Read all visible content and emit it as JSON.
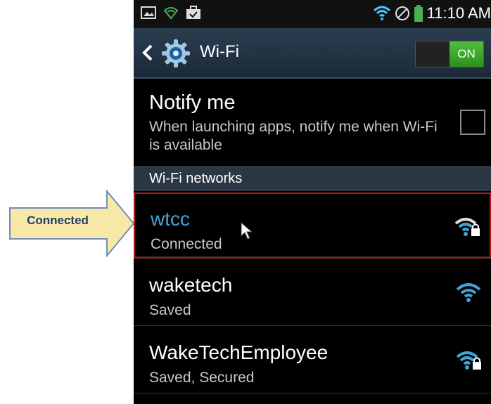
{
  "callout": {
    "label": "Connected"
  },
  "status_bar": {
    "time": "11:10 AM",
    "left_icons": [
      "image-icon",
      "wifi-outline-icon",
      "briefcase-check-icon"
    ],
    "right_icons": [
      "wifi-signal-icon",
      "no-sim-icon",
      "battery-icon"
    ]
  },
  "action_bar": {
    "title": "Wi-Fi",
    "toggle_label": "ON"
  },
  "notify": {
    "title": "Notify me",
    "description": "When launching apps, notify me when Wi-Fi is available",
    "checked": false
  },
  "networks_header": "Wi-Fi networks",
  "networks": [
    {
      "name": "wtcc",
      "status": "Connected",
      "secured": true,
      "highlighted": true,
      "name_color": "#3fa3d6"
    },
    {
      "name": "waketech",
      "status": "Saved",
      "secured": false,
      "highlighted": false,
      "name_color": "#ffffff"
    },
    {
      "name": "WakeTechEmployee",
      "status": "Saved, Secured",
      "secured": true,
      "highlighted": false,
      "name_color": "#ffffff"
    }
  ],
  "colors": {
    "accent": "#3fa3d6",
    "toggle_on": "#3fa22a",
    "highlight_border": "#b01a1a",
    "callout_fill": "#f7e8a8"
  }
}
